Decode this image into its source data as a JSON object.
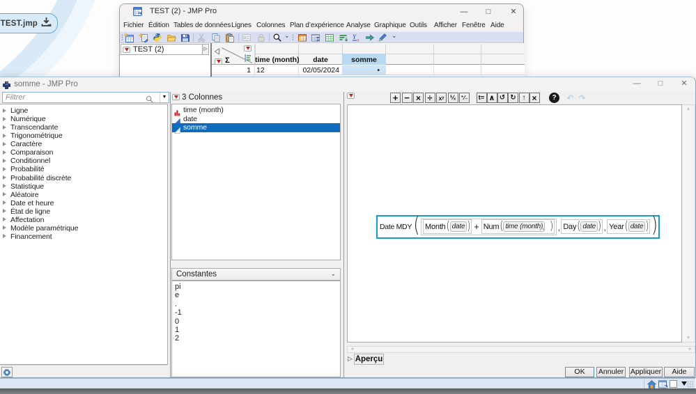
{
  "desktop": {
    "download_chip": {
      "label": "TEST.jmp"
    }
  },
  "data_window": {
    "title": "TEST (2) - JMP Pro",
    "menus": [
      "Fichier",
      "Édition",
      "Tables de données",
      "Lignes",
      "Colonnes",
      "Plan d’expérience",
      "Analyse",
      "Graphique",
      "Outils",
      "Afficher",
      "Fenêtre",
      "Aide"
    ],
    "side_panel": {
      "title": "TEST (2)"
    },
    "grid": {
      "sigma": "Σ",
      "columns": [
        "time (month)",
        "date",
        "somme"
      ],
      "row1": {
        "row_number": "1",
        "time_month": "12",
        "date": "02/05/2024",
        "somme": "•"
      }
    }
  },
  "formula_window": {
    "title": "somme - JMP Pro",
    "filter": {
      "placeholder": "Filtrer"
    },
    "function_categories": [
      "Ligne",
      "Numérique",
      "Transcendante",
      "Trigonométrique",
      "Caractère",
      "Comparaison",
      "Conditionnel",
      "Probabilité",
      "Probabilité discrète",
      "Statistique",
      "Aléatoire",
      "Date et heure",
      "État de ligne",
      "Affectation",
      "Modèle paramétrique",
      "Financement"
    ],
    "columns_panel": {
      "header": "3 Colonnes",
      "items": [
        {
          "label": "time (month)"
        },
        {
          "label": "date"
        },
        {
          "label": "somme"
        }
      ],
      "selected": "somme"
    },
    "constants_panel": {
      "header": "Constantes",
      "items": [
        "pi",
        "e",
        ".",
        "-1",
        "0",
        "1",
        "2"
      ]
    },
    "toolbar": {
      "buttons": [
        "+",
        "−",
        "×",
        "÷",
        "xʸ",
        "⅟ₓ",
        "⁺⁄₋",
        "t=",
        "∧",
        "↺",
        "↻",
        "↑",
        "×",
        "?",
        "↶",
        "↷"
      ]
    },
    "formula": {
      "fn": "Date MDY",
      "lp": "(",
      "rp": ")",
      "plus": "+",
      "comma": ",",
      "month_fn": "Month",
      "num_fn": "Num",
      "day_fn": "Day",
      "year_fn": "Year",
      "date_arg": "date",
      "time_arg": "time (month)"
    },
    "preview_label": "Aperçu",
    "buttons": {
      "ok": "OK",
      "cancel": "Annuler",
      "apply": "Appliquer",
      "help": "Aide"
    }
  }
}
